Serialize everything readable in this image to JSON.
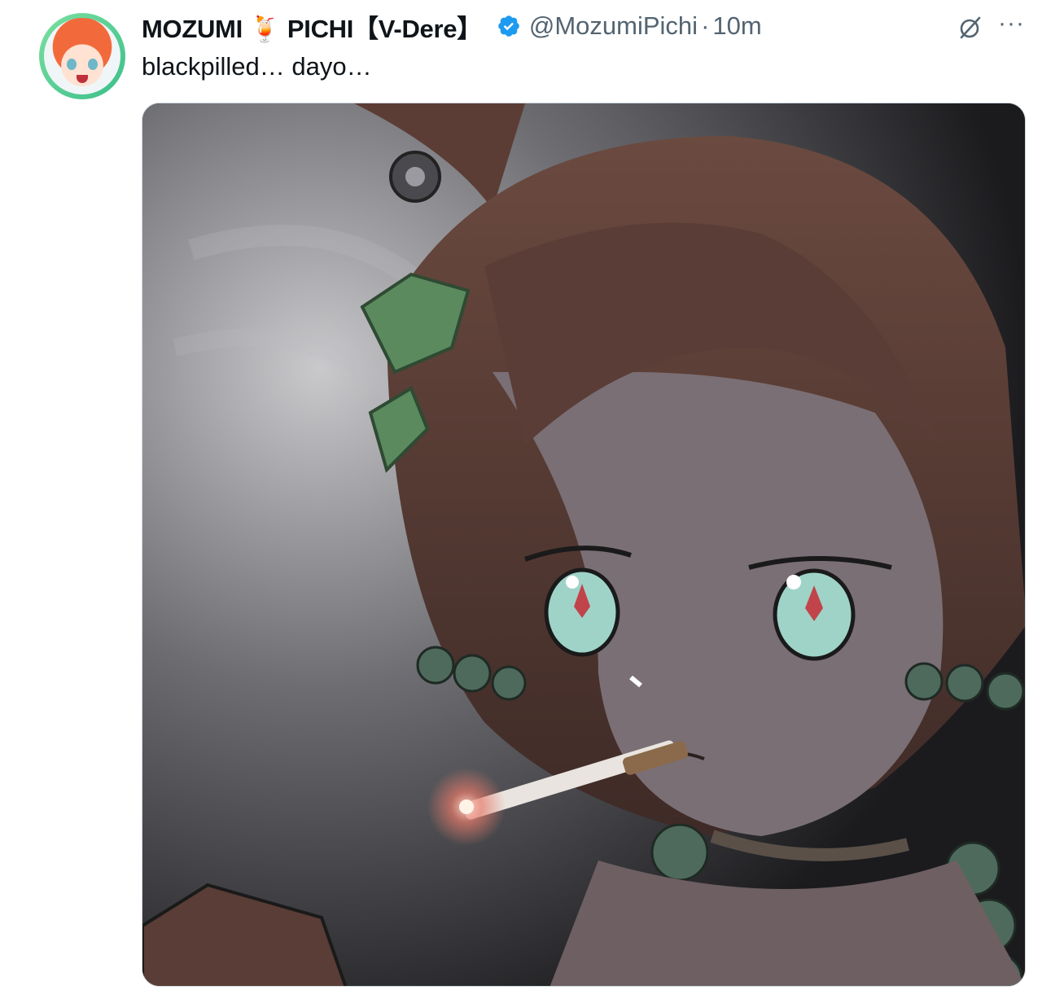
{
  "tweet": {
    "author_name_part1": "MOZUMI",
    "author_name_emoji": "🍹",
    "author_name_part2": "PICHI【V-Dere】",
    "handle": "@MozumiPichi",
    "separator": "·",
    "time": "10m",
    "text": "blackpilled… dayo…",
    "more_label": "···"
  },
  "icons": {
    "verified": "verified-badge-icon",
    "grok": "grok-icon",
    "more": "more-icon"
  },
  "colors": {
    "verified": "#1d9bf0",
    "text_primary": "#0f1419",
    "text_secondary": "#536471"
  }
}
